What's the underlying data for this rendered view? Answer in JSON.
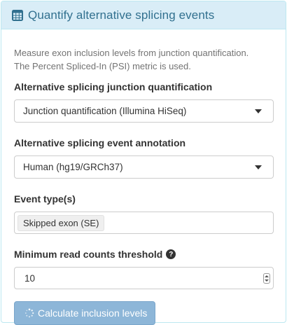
{
  "panel": {
    "title": "Quantify alternative splicing events",
    "title_icon": "table-icon",
    "help_line1": "Measure exon inclusion levels from junction quantification.",
    "help_line2": "The Percent Spliced-In (PSI) metric is used."
  },
  "junction": {
    "label": "Alternative splicing junction quantification",
    "value": "Junction quantification (Illumina HiSeq)"
  },
  "annotation": {
    "label": "Alternative splicing event annotation",
    "value": "Human (hg19/GRCh37)"
  },
  "event_type": {
    "label": "Event type(s)",
    "selected": "Skipped exon (SE)"
  },
  "threshold": {
    "label": "Minimum read counts threshold",
    "help_icon": "question-circle-icon",
    "value": "10"
  },
  "action": {
    "label": "Calculate inclusion levels",
    "icon": "spinner-icon"
  },
  "colors": {
    "heading_bg": "#d9edf7",
    "heading_text": "#31708f",
    "button_bg": "#8db6d8"
  }
}
